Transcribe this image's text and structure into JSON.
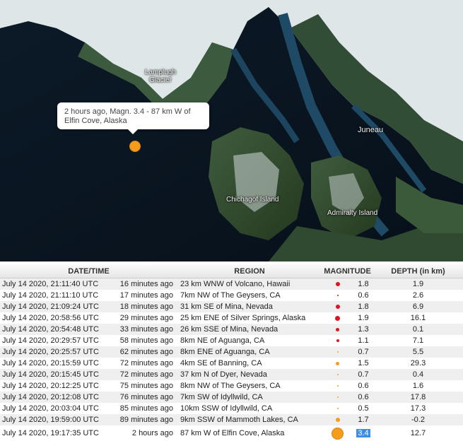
{
  "map": {
    "labels": {
      "lamplugh": "Lamplugh\nGlacier",
      "juneau": "Juneau",
      "chichagof": "Chichagof Island",
      "admiralty": "Admiralty Island"
    },
    "popup_text": "2 hours ago, Magn. 3.4 - 87 km W of Elfin Cove, Alaska",
    "marker_color": "#f59c1a"
  },
  "table": {
    "headers": {
      "date": "DATE/TIME",
      "region": "REGION",
      "magnitude": "MAGNITUDE",
      "depth": "DEPTH (in km)"
    },
    "rows": [
      {
        "date": "July 14 2020, 21:11:40 UTC",
        "ago": "16 minutes ago",
        "region": "23 km WNW of Volcano, Hawaii",
        "mag": "1.8",
        "depth": "1.9",
        "dot_color": "#e0141e"
      },
      {
        "date": "July 14 2020, 21:11:10 UTC",
        "ago": "17 minutes ago",
        "region": "7km NW of The Geysers, CA",
        "mag": "0.6",
        "depth": "2.6",
        "dot_color": "#e0141e"
      },
      {
        "date": "July 14 2020, 21:09:24 UTC",
        "ago": "18 minutes ago",
        "region": "31 km SE of Mina, Nevada",
        "mag": "1.8",
        "depth": "6.9",
        "dot_color": "#e0141e"
      },
      {
        "date": "July 14 2020, 20:58:56 UTC",
        "ago": "29 minutes ago",
        "region": "25 km ENE of Silver Springs, Alaska",
        "mag": "1.9",
        "depth": "16.1",
        "dot_color": "#e0141e"
      },
      {
        "date": "July 14 2020, 20:54:48 UTC",
        "ago": "33 minutes ago",
        "region": "26 km SSE of Mina, Nevada",
        "mag": "1.3",
        "depth": "0.1",
        "dot_color": "#e0141e"
      },
      {
        "date": "July 14 2020, 20:29:57 UTC",
        "ago": "58 minutes ago",
        "region": "8km NE of Aguanga, CA",
        "mag": "1.1",
        "depth": "7.1",
        "dot_color": "#e0141e"
      },
      {
        "date": "July 14 2020, 20:25:57 UTC",
        "ago": "62 minutes ago",
        "region": "8km ENE of Aguanga, CA",
        "mag": "0.7",
        "depth": "5.5",
        "dot_color": "#f59c1a"
      },
      {
        "date": "July 14 2020, 20:15:59 UTC",
        "ago": "72 minutes ago",
        "region": "4km SE of Banning, CA",
        "mag": "1.5",
        "depth": "29.3",
        "dot_color": "#f59c1a"
      },
      {
        "date": "July 14 2020, 20:15:45 UTC",
        "ago": "72 minutes ago",
        "region": "37 km N of Dyer, Nevada",
        "mag": "0.7",
        "depth": "0.4",
        "dot_color": "#f59c1a"
      },
      {
        "date": "July 14 2020, 20:12:25 UTC",
        "ago": "75 minutes ago",
        "region": "8km NW of The Geysers, CA",
        "mag": "0.6",
        "depth": "1.6",
        "dot_color": "#f59c1a"
      },
      {
        "date": "July 14 2020, 20:12:08 UTC",
        "ago": "76 minutes ago",
        "region": "7km SW of Idyllwild, CA",
        "mag": "0.6",
        "depth": "17.8",
        "dot_color": "#f59c1a"
      },
      {
        "date": "July 14 2020, 20:03:04 UTC",
        "ago": "85 minutes ago",
        "region": "10km SSW of Idyllwild, CA",
        "mag": "0.5",
        "depth": "17.3",
        "dot_color": "#f59c1a"
      },
      {
        "date": "July 14 2020, 19:59:00 UTC",
        "ago": "89 minutes ago",
        "region": "9km SSW of Mammoth Lakes, CA",
        "mag": "1.7",
        "depth": "-0.2",
        "dot_color": "#f59c1a"
      },
      {
        "date": "July 14 2020, 19:17:35 UTC",
        "ago": "2 hours ago",
        "region": "87 km W of Elfin Cove, Alaska",
        "mag": "3.4",
        "depth": "12.7",
        "dot_color": "#f59c1a"
      }
    ]
  }
}
